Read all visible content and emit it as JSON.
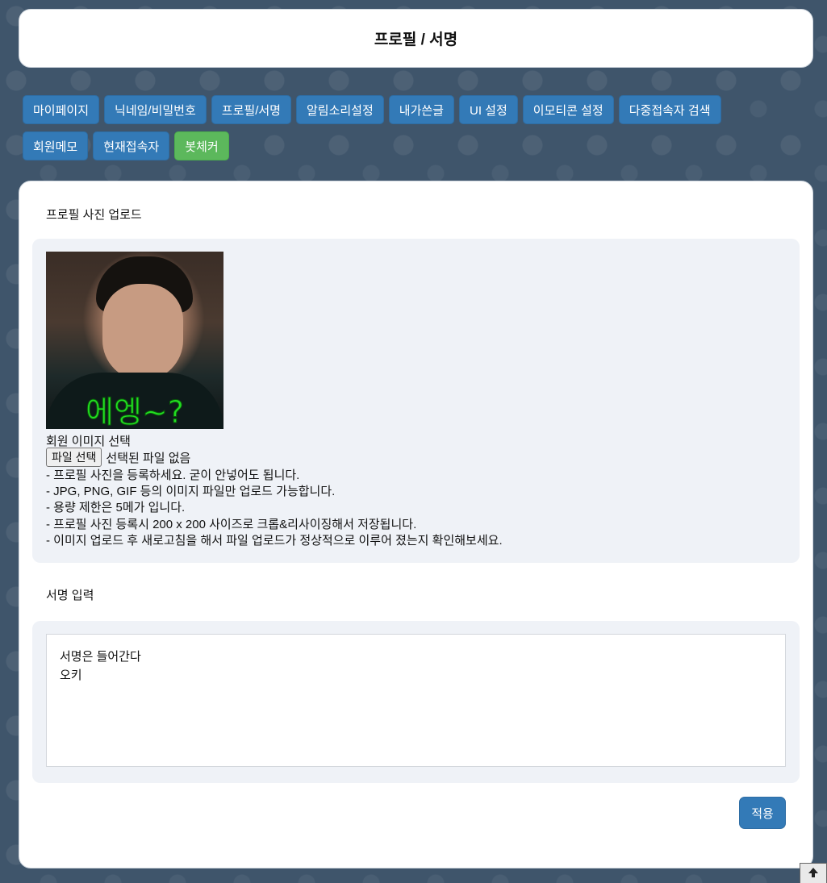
{
  "header": {
    "title": "프로필 / 서명"
  },
  "nav": {
    "row1": [
      "마이페이지",
      "닉네임/비밀번호",
      "프로필/서명",
      "알림소리설정",
      "내가쓴글",
      "UI 설정",
      "이모티콘 설정",
      "다중접속자 검색"
    ],
    "row2": [
      "회원메모",
      "현재접속자"
    ],
    "active": "봇체커"
  },
  "profile": {
    "section_title": "프로필 사진 업로드",
    "image_caption": "에엥~?",
    "select_label": "회원 이미지 선택",
    "file_button": "파일 선택",
    "file_status": "선택된 파일 없음",
    "notes": [
      "- 프로필 사진을 등록하세요. 굳이 안넣어도 됩니다.",
      "- JPG, PNG, GIF 등의 이미지 파일만 업로드 가능합니다.",
      "- 용량 제한은 5메가 입니다.",
      "- 프로필 사진 등록시 200 x 200 사이즈로 크롭&리사이징해서 저장됩니다.",
      "- 이미지 업로드 후 새로고침을 해서 파일 업로드가 정상적으로 이루어 졌는지 확인해보세요."
    ]
  },
  "signature": {
    "section_title": "서명 입력",
    "value": "서명은 들어간다\n오키"
  },
  "actions": {
    "apply": "적용"
  },
  "colors": {
    "primary": "#337ab7",
    "success": "#5cb85c",
    "background": "#3f556b"
  },
  "icons": {
    "scroll_top": "arrow-up-icon"
  }
}
